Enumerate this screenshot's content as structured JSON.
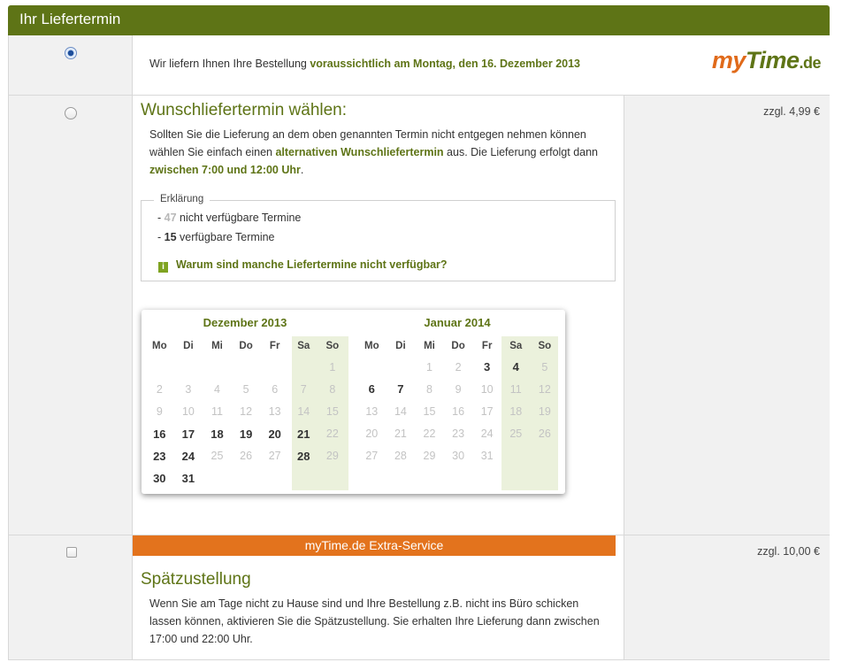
{
  "header": {
    "title": "Ihr Liefertermin"
  },
  "standard_delivery": {
    "selected": true,
    "text_prefix": "Wir liefern Ihnen Ihre Bestellung ",
    "text_bold": "voraussichtlich am Montag, den 16. Dezember 2013",
    "logo": {
      "my": "my",
      "time": "Time",
      "de": ".de"
    }
  },
  "wish_delivery": {
    "title": "Wunschliefertermin wählen:",
    "desc": {
      "p1": "Sollten Sie die Lieferung an dem oben genannten Termin nicht entgegen nehmen können wählen Sie einfach einen ",
      "b1": "alternativen Wunschliefertermin",
      "p2": " aus. Die Lieferung erfolgt dann ",
      "b2": "zwischen 7:00 und 12:00 Uhr",
      "p3": "."
    },
    "price": "zzgl. 4,99 €",
    "legend": {
      "title": "Erklärung",
      "dash": "-",
      "unavailable_count": "47",
      "unavailable_label": "nicht verfügbare Termine",
      "available_count": "15",
      "available_label": "verfügbare Termine",
      "info_icon": "info-icon",
      "info_icon_glyph": "i",
      "info_link": "Warum sind manche Liefertermine nicht verfügbar?"
    },
    "calendars": [
      {
        "title": "Dezember 2013",
        "weekdays": [
          "Mo",
          "Di",
          "Mi",
          "Do",
          "Fr",
          "Sa",
          "So"
        ],
        "weeks": [
          [
            {
              "d": ""
            },
            {
              "d": ""
            },
            {
              "d": ""
            },
            {
              "d": ""
            },
            {
              "d": ""
            },
            {
              "d": ""
            },
            {
              "d": "1"
            }
          ],
          [
            {
              "d": "2"
            },
            {
              "d": "3"
            },
            {
              "d": "4"
            },
            {
              "d": "5"
            },
            {
              "d": "6"
            },
            {
              "d": "7"
            },
            {
              "d": "8"
            }
          ],
          [
            {
              "d": "9"
            },
            {
              "d": "10"
            },
            {
              "d": "11"
            },
            {
              "d": "12"
            },
            {
              "d": "13"
            },
            {
              "d": "14"
            },
            {
              "d": "15"
            }
          ],
          [
            {
              "d": "16",
              "a": true
            },
            {
              "d": "17",
              "a": true
            },
            {
              "d": "18",
              "a": true
            },
            {
              "d": "19",
              "a": true
            },
            {
              "d": "20",
              "a": true
            },
            {
              "d": "21",
              "a": true
            },
            {
              "d": "22"
            }
          ],
          [
            {
              "d": "23",
              "a": true
            },
            {
              "d": "24",
              "a": true
            },
            {
              "d": "25"
            },
            {
              "d": "26"
            },
            {
              "d": "27"
            },
            {
              "d": "28",
              "a": true
            },
            {
              "d": "29"
            }
          ],
          [
            {
              "d": "30",
              "a": true
            },
            {
              "d": "31",
              "a": true
            },
            {
              "d": ""
            },
            {
              "d": ""
            },
            {
              "d": ""
            },
            {
              "d": ""
            },
            {
              "d": ""
            }
          ]
        ]
      },
      {
        "title": "Januar 2014",
        "weekdays": [
          "Mo",
          "Di",
          "Mi",
          "Do",
          "Fr",
          "Sa",
          "So"
        ],
        "weeks": [
          [
            {
              "d": ""
            },
            {
              "d": ""
            },
            {
              "d": "1"
            },
            {
              "d": "2"
            },
            {
              "d": "3",
              "a": true
            },
            {
              "d": "4",
              "a": true
            },
            {
              "d": "5"
            }
          ],
          [
            {
              "d": "6",
              "a": true
            },
            {
              "d": "7",
              "a": true
            },
            {
              "d": "8"
            },
            {
              "d": "9"
            },
            {
              "d": "10"
            },
            {
              "d": "11"
            },
            {
              "d": "12"
            }
          ],
          [
            {
              "d": "13"
            },
            {
              "d": "14"
            },
            {
              "d": "15"
            },
            {
              "d": "16"
            },
            {
              "d": "17"
            },
            {
              "d": "18"
            },
            {
              "d": "19"
            }
          ],
          [
            {
              "d": "20"
            },
            {
              "d": "21"
            },
            {
              "d": "22"
            },
            {
              "d": "23"
            },
            {
              "d": "24"
            },
            {
              "d": "25"
            },
            {
              "d": "26"
            }
          ],
          [
            {
              "d": "27"
            },
            {
              "d": "28"
            },
            {
              "d": "29"
            },
            {
              "d": "30"
            },
            {
              "d": "31"
            },
            {
              "d": ""
            },
            {
              "d": ""
            }
          ]
        ]
      }
    ]
  },
  "late_delivery": {
    "banner": "myTime.de Extra-Service",
    "title": "Spätzustellung",
    "desc": "Wenn Sie am Tage nicht zu Hause sind und Ihre Bestellung z.B. nicht ins Büro schicken lassen können, aktivieren Sie die Spätzustellung. Sie erhalten Ihre Lieferung dann zwischen 17:00 und 22:00 Uhr.",
    "price": "zzgl. 10,00 €",
    "checked": false
  },
  "colors": {
    "header_green": "#5e7416",
    "accent_orange": "#e3731d",
    "weekend_bg": "#ebf1dc",
    "unavailable_grey": "#c3c3c3"
  }
}
